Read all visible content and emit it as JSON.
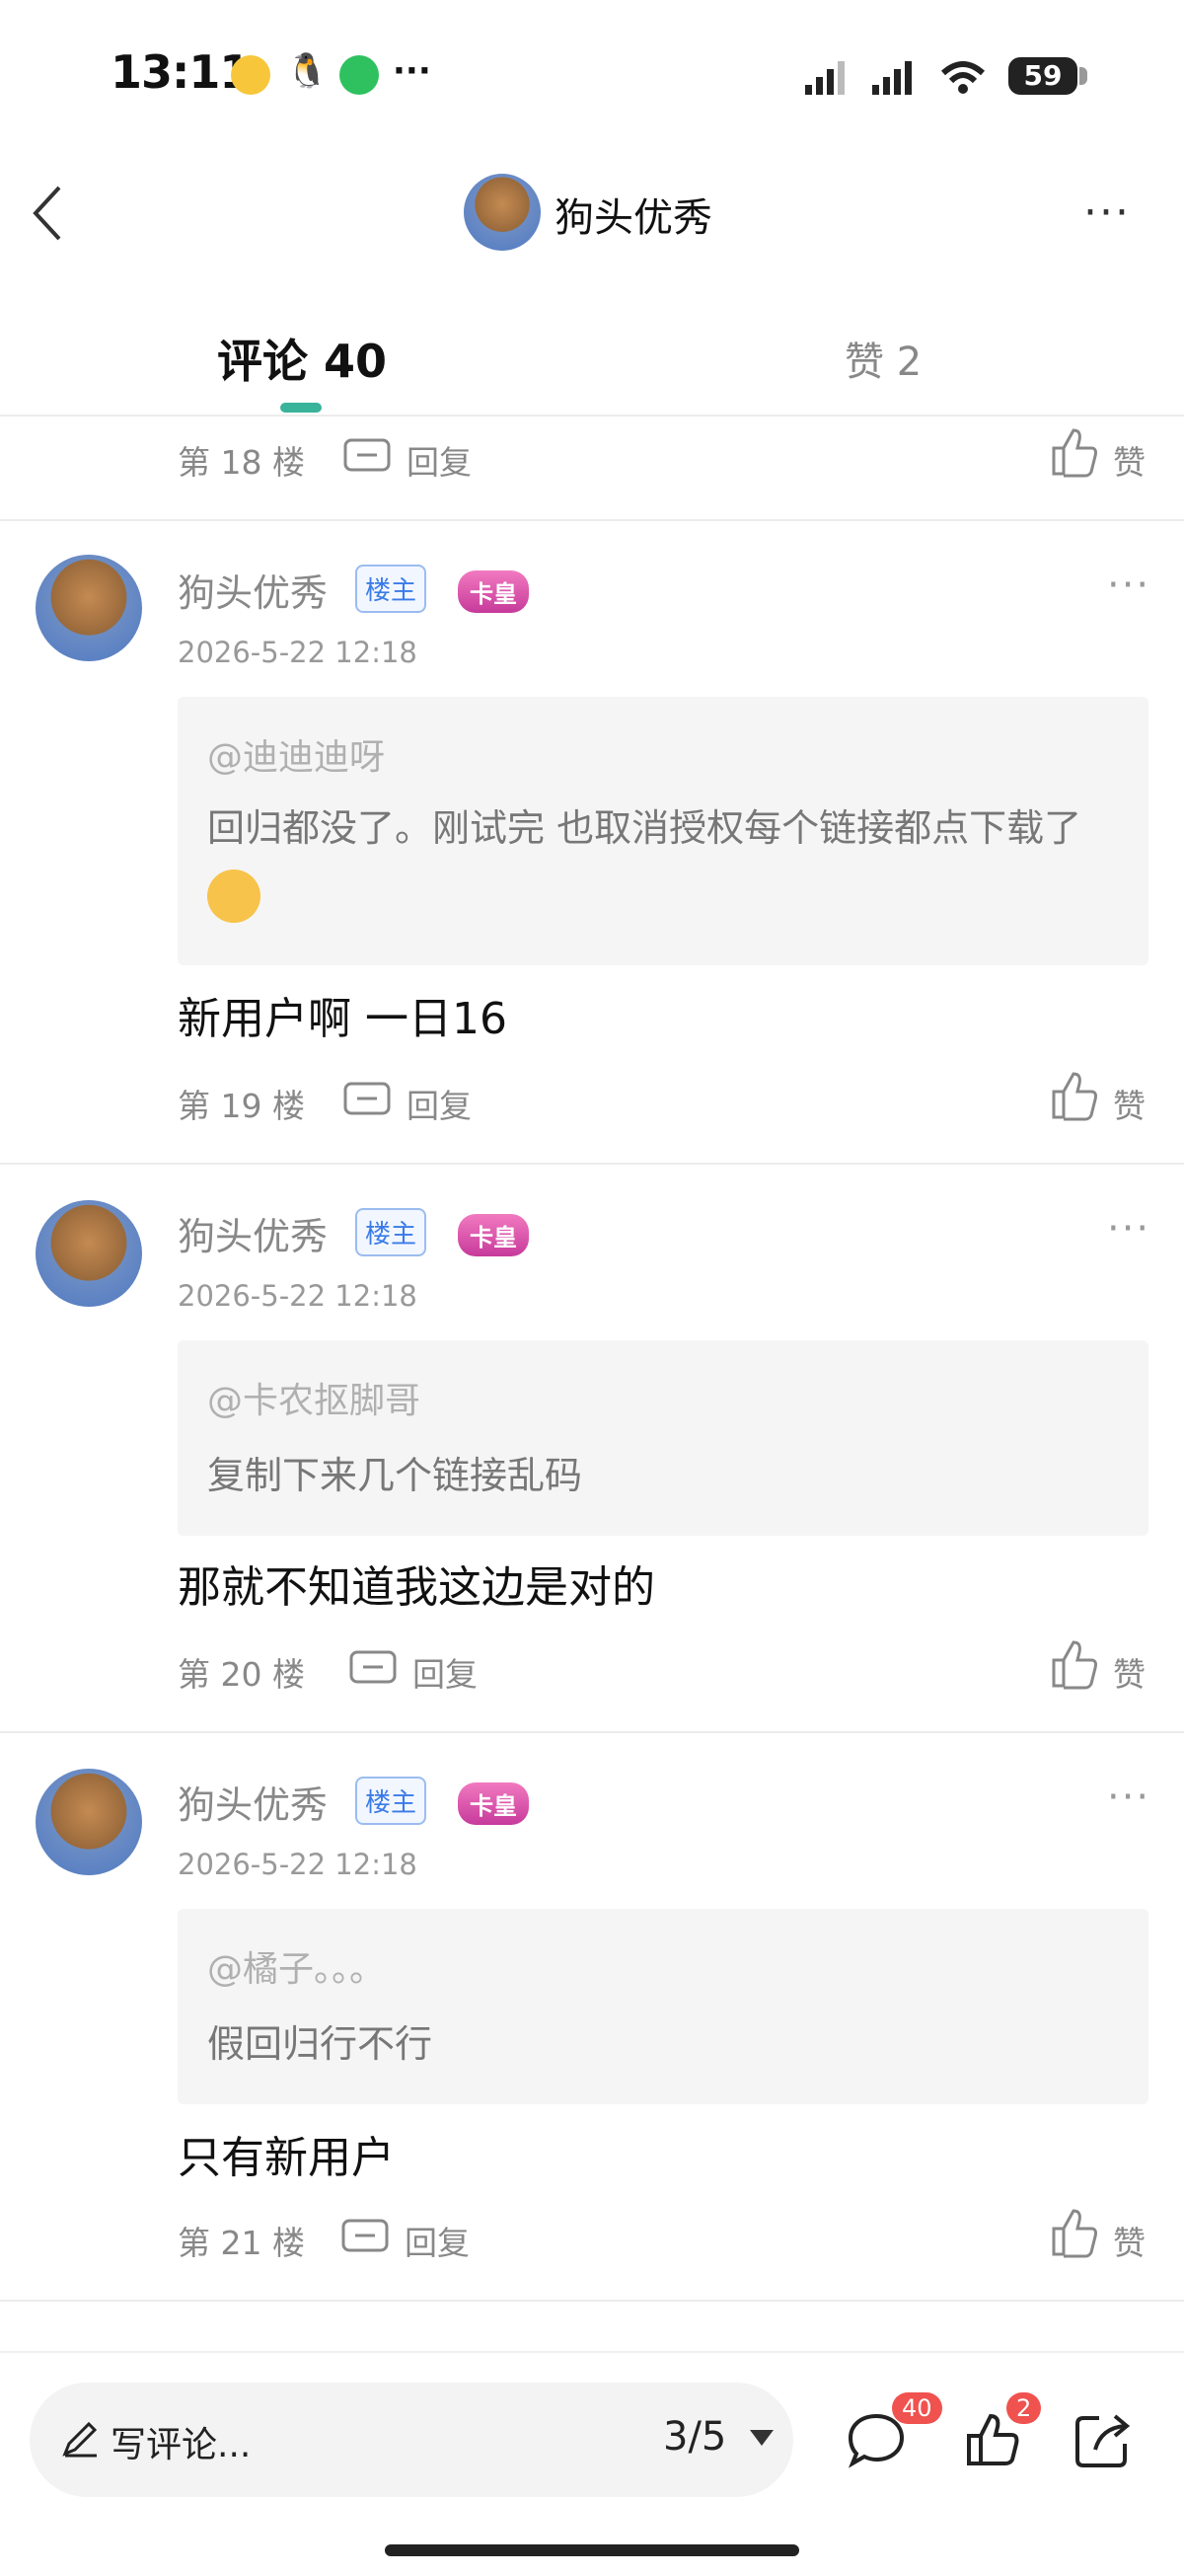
{
  "status_bar": {
    "time": "13:11",
    "battery": "59",
    "extra": "···"
  },
  "header": {
    "title": "狗头优秀",
    "more": "···"
  },
  "tabs": [
    {
      "label": "评论 40"
    },
    {
      "label": "赞 2"
    }
  ],
  "partial_floor": {
    "floor": "第 18 楼",
    "reply": "回复",
    "like": "赞"
  },
  "comments": [
    {
      "name": "狗头优秀",
      "badge": "楼主",
      "crown": "卡皇",
      "date": "2026-5-22 12:18",
      "quote_mention": "@迪迪迪呀",
      "quote_text": "回归都没了。刚试完 也取消授权每个链接都点下载了",
      "body": "新用户啊 一日16",
      "floor": "第 19 楼",
      "reply": "回复",
      "like": "赞"
    },
    {
      "name": "狗头优秀",
      "badge": "楼主",
      "crown": "卡皇",
      "date": "2026-5-22 12:18",
      "quote_mention": "@卡农抠脚哥",
      "quote_text": "复制下来几个链接乱码",
      "body": "那就不知道我这边是对的",
      "floor": "第 20 楼",
      "reply": "回复",
      "like": "赞"
    },
    {
      "name": "狗头优秀",
      "badge": "楼主",
      "crown": "卡皇",
      "date": "2026-5-22 12:18",
      "quote_mention": "@橘子。。。",
      "quote_text": "假回归行不行",
      "body": "只有新用户",
      "floor": "第 21 楼",
      "reply": "回复",
      "like": "赞"
    }
  ],
  "bottom_bar": {
    "write_placeholder": "写评论...",
    "page": "3/5",
    "comment_count": "40",
    "like_count": "2"
  },
  "colors": {
    "accent": "#39b39a",
    "badge_blue": "#3b7be8",
    "red_badge": "#f0524f"
  }
}
